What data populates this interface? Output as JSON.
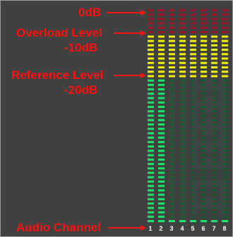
{
  "labels": {
    "zero_db": "0dB",
    "overload_level": "Overload Level",
    "overload_db": "-10dB",
    "reference_level": "Reference Level",
    "reference_db": "-20dB",
    "audio_channel": "Audio Channel"
  },
  "channels": [
    "1",
    "2",
    "3",
    "4",
    "5",
    "6",
    "7",
    "8"
  ],
  "meter": {
    "segments_total": 49,
    "zones": {
      "red_segments": 6,
      "yellow_segments": 10,
      "green_segments": 33
    },
    "channel_active_green_segments": [
      33,
      33,
      1,
      1,
      1,
      1,
      1,
      1
    ]
  },
  "colors": {
    "background": "#414141",
    "annotation": "#ff1414",
    "red_lit": "#9a1a2a",
    "red_dim": "#5a2630",
    "yellow_lit": "#f0f000",
    "green_lit": "#19e66a",
    "green_dim": "#1d5a33",
    "channel_label": "#ffffff"
  }
}
